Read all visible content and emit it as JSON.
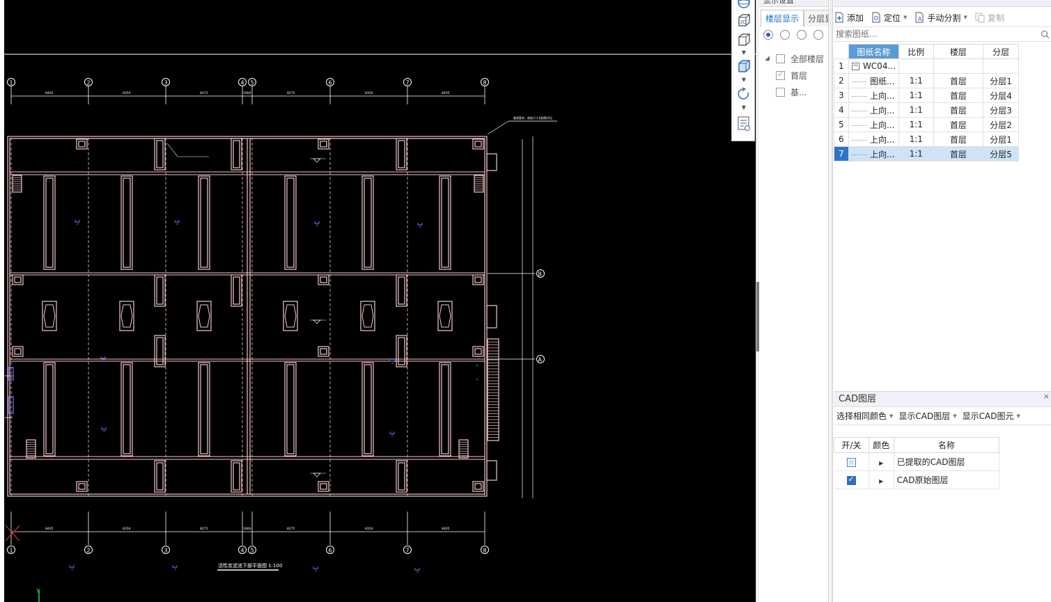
{
  "cad": {
    "axis_numbers": [
      "1",
      "2",
      "3",
      "4",
      "5",
      "6",
      "7",
      "8"
    ],
    "axis_letters": [
      "A",
      "B"
    ],
    "dim_labels": [
      "8405",
      "8350",
      "8275",
      "1900",
      "8275",
      "8350",
      "8405"
    ],
    "drawing_title": "活性炭滤池下部平面图 1:100",
    "note_text": "备案要求，底板尺寸及配筋详见",
    "ucs_y": "Y",
    "colors": {
      "background": "#000000",
      "linework": "#f4c8cc",
      "annotation": "#6f7bff",
      "axis": "#ffffff"
    }
  },
  "view_toolbar": {
    "icons": [
      "sphere-view-icon",
      "3d-view-icon",
      "box-view-icon",
      "box-view-blue-icon",
      "rotate-icon",
      "layer-properties-icon"
    ],
    "label_3d": "3D"
  },
  "floor_panel": {
    "header": "显示设置",
    "tabs": [
      "楼层显示",
      "分层显示"
    ],
    "tree": [
      {
        "label": "全部楼层",
        "checked": false
      },
      {
        "label": "首层",
        "checked": true
      },
      {
        "label": "基...",
        "checked": false
      }
    ]
  },
  "drawing_panel": {
    "header": "图纸管理",
    "toolbar": {
      "add": "添加",
      "locate": "定位",
      "split": "手动分割",
      "copy": "复制"
    },
    "search_placeholder": "搜索图纸...",
    "columns": [
      "图纸名称",
      "比例",
      "楼层",
      "分层"
    ],
    "rows": [
      {
        "num": "1",
        "name": "WC04...",
        "scale": "",
        "floor": "",
        "layer": ""
      },
      {
        "num": "2",
        "name": "图纸...",
        "scale": "1:1",
        "floor": "首层",
        "layer": "分层1"
      },
      {
        "num": "3",
        "name": "上向...",
        "scale": "1:1",
        "floor": "首层",
        "layer": "分层4"
      },
      {
        "num": "4",
        "name": "上向...",
        "scale": "1:1",
        "floor": "首层",
        "layer": "分层3"
      },
      {
        "num": "5",
        "name": "上向...",
        "scale": "1:1",
        "floor": "首层",
        "layer": "分层2"
      },
      {
        "num": "6",
        "name": "上向...",
        "scale": "1:1",
        "floor": "首层",
        "layer": "分层1"
      },
      {
        "num": "7",
        "name": "上向...",
        "scale": "1:1",
        "floor": "首层",
        "layer": "分层5"
      }
    ],
    "selected_row": "7"
  },
  "cad_layers": {
    "title": "CAD图层",
    "close": "×",
    "toolbar": [
      "选择相同颜色",
      "显示CAD图层",
      "显示CAD图元"
    ],
    "columns": [
      "开/关",
      "颜色",
      "名称"
    ],
    "rows": [
      {
        "name": "已提取的CAD图层",
        "on": false
      },
      {
        "name": "CAD原始图层",
        "on": true
      }
    ]
  }
}
